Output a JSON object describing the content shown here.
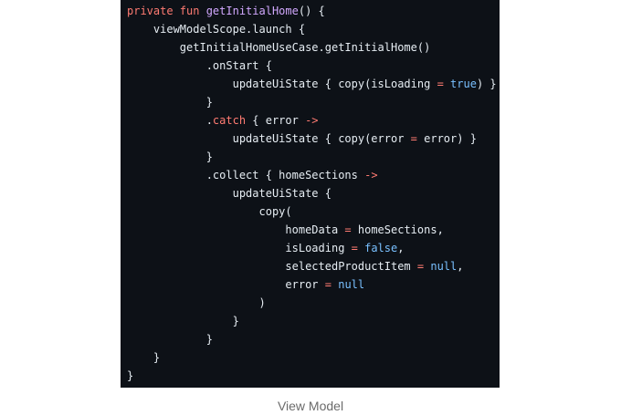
{
  "colors": {
    "background": "#0d1117",
    "keyword": "#ff7b72",
    "function": "#d2a8ff",
    "plain": "#e6edf3",
    "literal": "#79c0ff"
  },
  "code": {
    "lines": [
      [
        {
          "t": "private fun ",
          "c": "keyword"
        },
        {
          "t": "getInitialHome",
          "c": "function"
        },
        {
          "t": "() {",
          "c": "plain"
        }
      ],
      [
        {
          "t": "    viewModelScope.launch {",
          "c": "plain"
        }
      ],
      [
        {
          "t": "        getInitialHomeUseCase.getInitialHome()",
          "c": "plain"
        }
      ],
      [
        {
          "t": "            .onStart {",
          "c": "plain"
        }
      ],
      [
        {
          "t": "                updateUiState { copy(isLoading ",
          "c": "plain"
        },
        {
          "t": "=",
          "c": "keyword"
        },
        {
          "t": " ",
          "c": "plain"
        },
        {
          "t": "true",
          "c": "literal"
        },
        {
          "t": ") }",
          "c": "plain"
        }
      ],
      [
        {
          "t": "            }",
          "c": "plain"
        }
      ],
      [
        {
          "t": "            .",
          "c": "plain"
        },
        {
          "t": "catch",
          "c": "keyword"
        },
        {
          "t": " { error ",
          "c": "plain"
        },
        {
          "t": "->",
          "c": "keyword"
        }
      ],
      [
        {
          "t": "                updateUiState { copy(error ",
          "c": "plain"
        },
        {
          "t": "=",
          "c": "keyword"
        },
        {
          "t": " error) }",
          "c": "plain"
        }
      ],
      [
        {
          "t": "            }",
          "c": "plain"
        }
      ],
      [
        {
          "t": "            .collect { homeSections ",
          "c": "plain"
        },
        {
          "t": "->",
          "c": "keyword"
        }
      ],
      [
        {
          "t": "                updateUiState {",
          "c": "plain"
        }
      ],
      [
        {
          "t": "                    copy(",
          "c": "plain"
        }
      ],
      [
        {
          "t": "                        homeData ",
          "c": "plain"
        },
        {
          "t": "=",
          "c": "keyword"
        },
        {
          "t": " homeSections,",
          "c": "plain"
        }
      ],
      [
        {
          "t": "                        isLoading ",
          "c": "plain"
        },
        {
          "t": "=",
          "c": "keyword"
        },
        {
          "t": " ",
          "c": "plain"
        },
        {
          "t": "false",
          "c": "literal"
        },
        {
          "t": ",",
          "c": "plain"
        }
      ],
      [
        {
          "t": "                        selectedProductItem ",
          "c": "plain"
        },
        {
          "t": "=",
          "c": "keyword"
        },
        {
          "t": " ",
          "c": "plain"
        },
        {
          "t": "null",
          "c": "literal"
        },
        {
          "t": ",",
          "c": "plain"
        }
      ],
      [
        {
          "t": "                        error ",
          "c": "plain"
        },
        {
          "t": "=",
          "c": "keyword"
        },
        {
          "t": " ",
          "c": "plain"
        },
        {
          "t": "null",
          "c": "literal"
        }
      ],
      [
        {
          "t": "                    )",
          "c": "plain"
        }
      ],
      [
        {
          "t": "                }",
          "c": "plain"
        }
      ],
      [
        {
          "t": "            }",
          "c": "plain"
        }
      ],
      [
        {
          "t": "    }",
          "c": "plain"
        }
      ],
      [
        {
          "t": "}",
          "c": "plain"
        }
      ]
    ]
  },
  "caption": "View Model"
}
